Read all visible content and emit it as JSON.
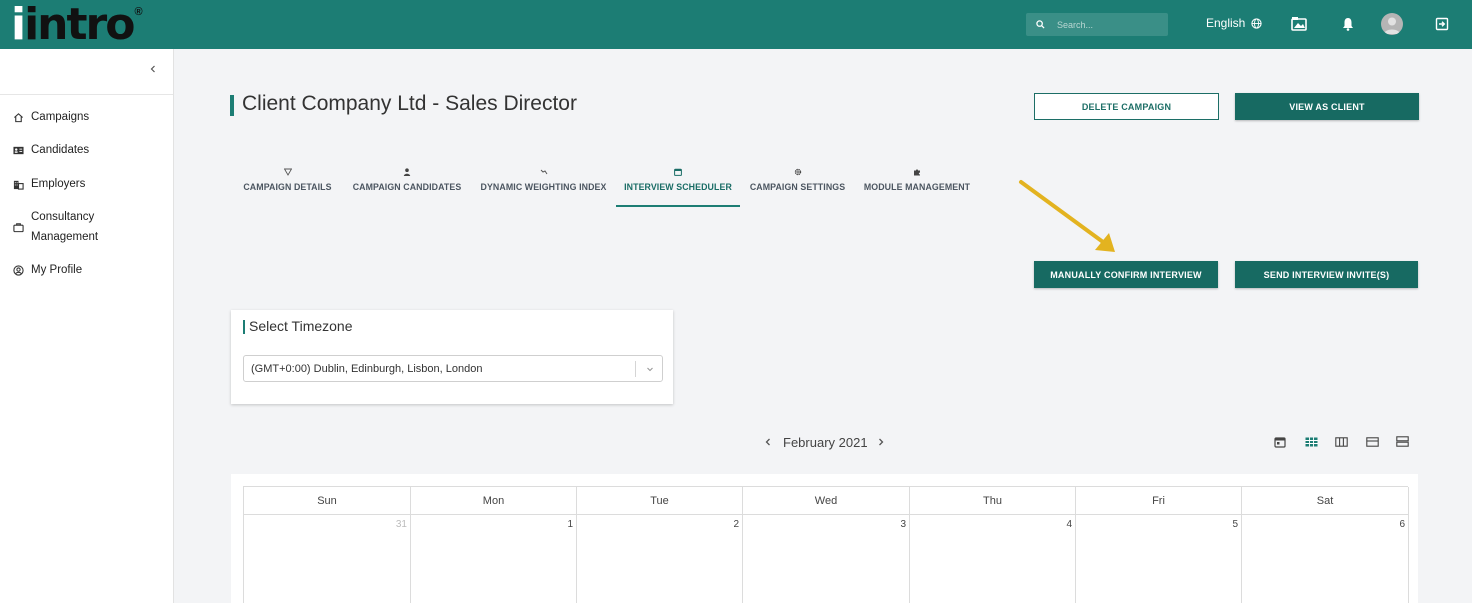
{
  "brand": {
    "logo_text": "intro",
    "logo_prefix": "i",
    "registered": "®",
    "primary_color": "#1c7d74"
  },
  "topbar": {
    "search_placeholder": "Search...",
    "language": "English",
    "icons": [
      "search-icon",
      "globe-icon",
      "media-icon",
      "bell-icon",
      "avatar",
      "logout-icon"
    ]
  },
  "sidebar": {
    "items": [
      {
        "label": "Campaigns",
        "icon": "home-icon"
      },
      {
        "label": "Candidates",
        "icon": "id-card-icon"
      },
      {
        "label": "Employers",
        "icon": "building-icon"
      },
      {
        "label": "Consultancy",
        "label2": "Management",
        "icon": "briefcase-icon"
      },
      {
        "label": "My Profile",
        "icon": "user-circle-icon"
      }
    ]
  },
  "page": {
    "title": "Client Company Ltd - Sales Director",
    "delete_button": "DELETE CAMPAIGN",
    "view_button": "VIEW AS CLIENT",
    "manual_button": "MANUALLY CONFIRM INTERVIEW",
    "invite_button": "SEND INTERVIEW INVITE(S)"
  },
  "tabs": [
    {
      "label": "CAMPAIGN DETAILS",
      "icon": "funnel-icon",
      "active": false
    },
    {
      "label": "CAMPAIGN CANDIDATES",
      "icon": "person-icon",
      "active": false
    },
    {
      "label": "DYNAMIC WEIGHTING INDEX",
      "icon": "scale-icon",
      "active": false
    },
    {
      "label": "INTERVIEW SCHEDULER",
      "icon": "calendar-icon",
      "active": true
    },
    {
      "label": "CAMPAIGN SETTINGS",
      "icon": "cog-icon",
      "active": false
    },
    {
      "label": "MODULE MANAGEMENT",
      "icon": "puzzle-icon",
      "active": false
    }
  ],
  "timezone": {
    "title": "Select Timezone",
    "selected": "(GMT+0:00) Dublin, Edinburgh, Lisbon, London"
  },
  "calendar": {
    "month": "February 2021",
    "weekdays": [
      "Sun",
      "Mon",
      "Tue",
      "Wed",
      "Thu",
      "Fri",
      "Sat"
    ],
    "first_row": [
      "31",
      "1",
      "2",
      "3",
      "4",
      "5",
      "6"
    ],
    "view_icons": [
      "calendar-today-icon",
      "month-view-icon",
      "week-view-icon",
      "day-view-icon",
      "list-view-icon"
    ]
  }
}
